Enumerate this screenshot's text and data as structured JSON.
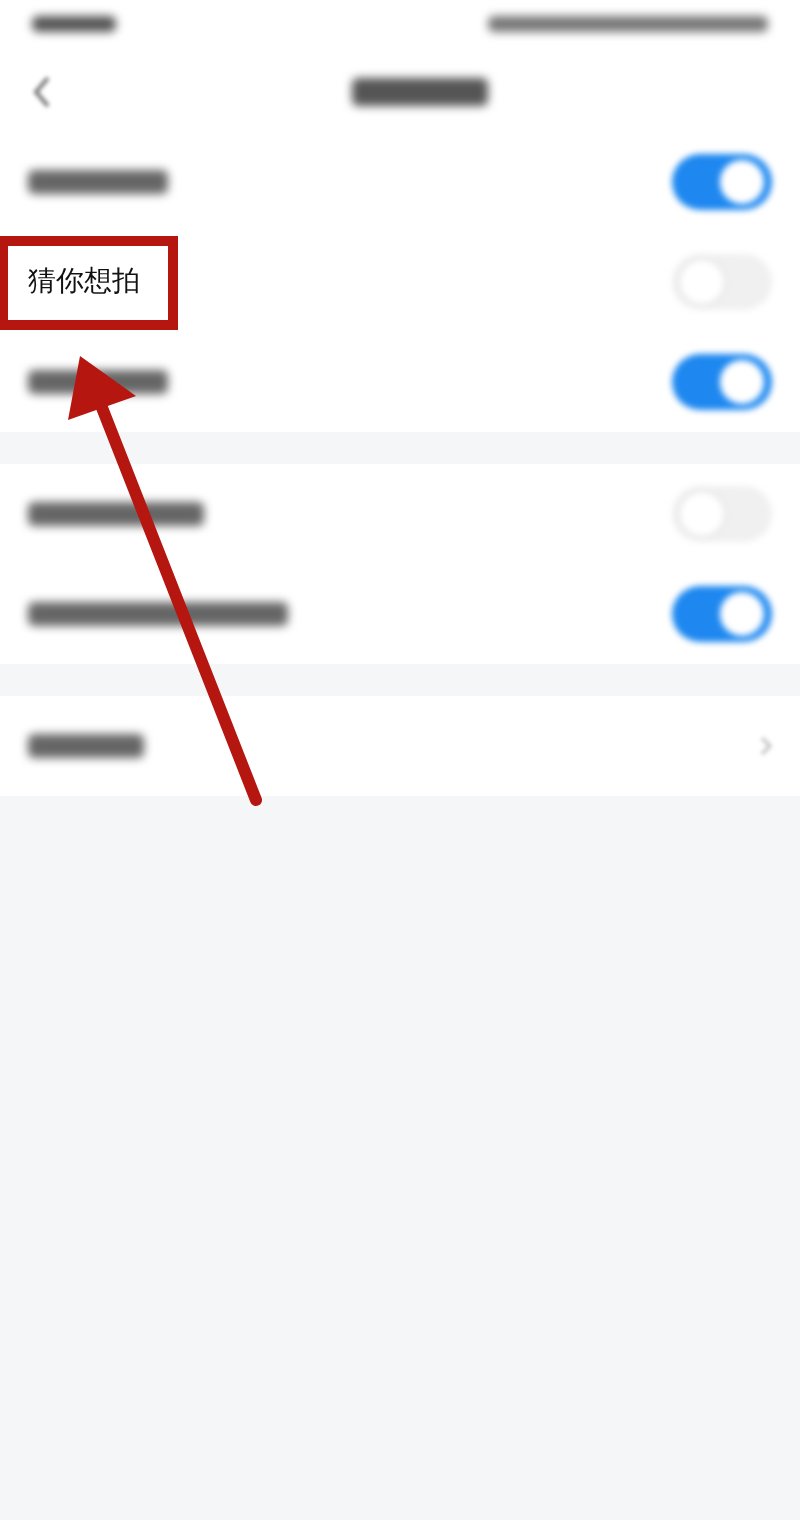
{
  "sections": [
    {
      "rows": [
        {
          "kind": "toggle",
          "on": true
        },
        {
          "kind": "toggle",
          "on": false,
          "label": "猜你想拍",
          "highlighted": true
        },
        {
          "kind": "toggle",
          "on": true
        }
      ]
    },
    {
      "rows": [
        {
          "kind": "toggle",
          "on": false
        },
        {
          "kind": "toggle",
          "on": true
        }
      ]
    },
    {
      "rows": [
        {
          "kind": "link"
        }
      ]
    }
  ]
}
